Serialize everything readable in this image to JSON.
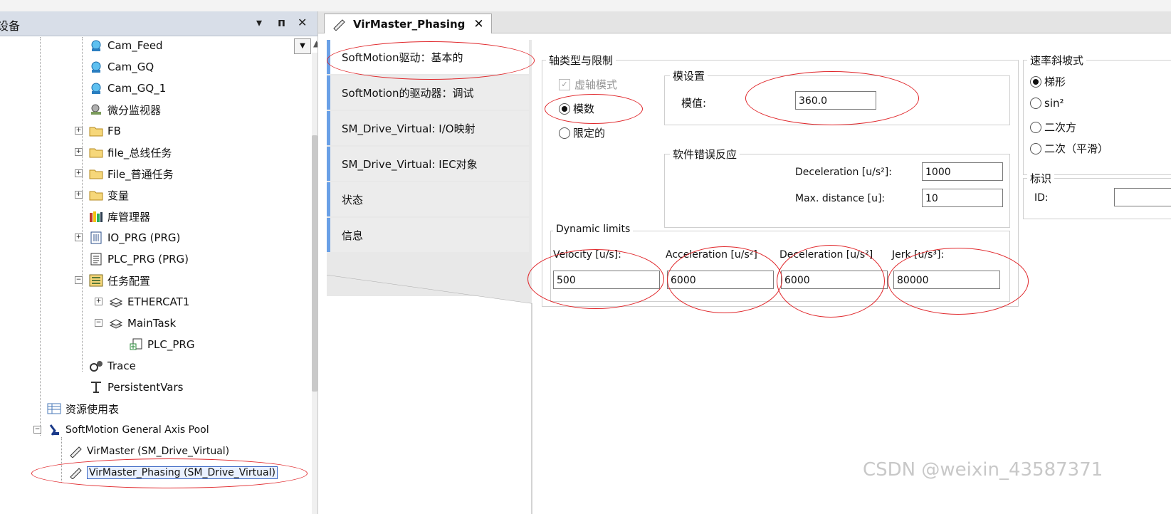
{
  "left_panel": {
    "title": "设备",
    "header_controls": [
      "▾",
      "ᴨ",
      "✕"
    ],
    "tree": [
      {
        "label": "Cam_Feed"
      },
      {
        "label": "Cam_GQ"
      },
      {
        "label": "Cam_GQ_1"
      },
      {
        "label": "微分监视器"
      },
      {
        "label": "FB"
      },
      {
        "label": "file_总线任务"
      },
      {
        "label": "File_普通任务"
      },
      {
        "label": "变量"
      },
      {
        "label": "库管理器"
      },
      {
        "label": "IO_PRG (PRG)"
      },
      {
        "label": "PLC_PRG (PRG)"
      },
      {
        "label": "任务配置"
      },
      {
        "label": "ETHERCAT1"
      },
      {
        "label": "MainTask"
      },
      {
        "label": "PLC_PRG"
      },
      {
        "label": "Trace"
      },
      {
        "label": "PersistentVars"
      },
      {
        "label": "资源使用表"
      },
      {
        "label": "SoftMotion General Axis Pool"
      },
      {
        "label": "VirMaster (SM_Drive_Virtual)"
      },
      {
        "label": "VirMaster_Phasing (SM_Drive_Virtual)"
      }
    ]
  },
  "editor": {
    "tab_title": "VirMaster_Phasing",
    "tab_close": "✕",
    "side_tabs": [
      {
        "label": "SoftMotion驱动：基本的"
      },
      {
        "label": "SoftMotion的驱动器：调试"
      },
      {
        "label": "SM_Drive_Virtual: I/O映射"
      },
      {
        "label": "SM_Drive_Virtual: IEC对象"
      },
      {
        "label": "状态"
      },
      {
        "label": "信息"
      }
    ],
    "axis_group": {
      "title": "轴类型与限制",
      "virtual_mode_label": "虚轴模式",
      "virtual_mode_checked": true,
      "modulo_label": "模数",
      "limited_label": "限定的",
      "selected": "模数"
    },
    "modulo_settings": {
      "title": "模设置",
      "value_label": "模值:",
      "value": "360.0"
    },
    "software_error": {
      "title": "软件错误反应",
      "decel_label": "Deceleration [u/s²]:",
      "decel_value": "1000",
      "maxdist_label": "Max. distance [u]:",
      "maxdist_value": "10"
    },
    "dynamic_limits": {
      "title": "Dynamic limits",
      "velocity_label": "Velocity [u/s]:",
      "velocity_value": "500",
      "accel_label": "Acceleration [u/s²]",
      "accel_value": "6000",
      "decel_label": "Deceleration [u/s²]",
      "decel_value": "6000",
      "jerk_label": "Jerk [u/s³]:",
      "jerk_value": "80000"
    },
    "ramp": {
      "title": "速率斜坡式",
      "options": [
        "梯形",
        "sin²",
        "二次方",
        "二次（平滑）"
      ],
      "selected": "梯形"
    },
    "identity": {
      "title": "标识",
      "id_label": "ID:"
    }
  },
  "watermark": "CSDN @weixin_43587371",
  "colors": {
    "annotation_red": "#e0262a",
    "tab_accent": "#6aa0e6",
    "selection_border": "#3a66c4"
  }
}
